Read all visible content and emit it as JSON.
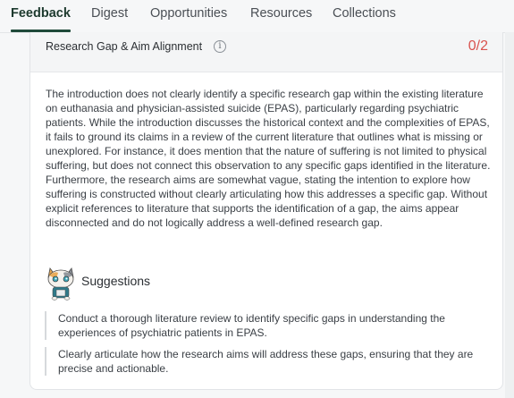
{
  "tabs": [
    {
      "label": "Feedback",
      "active": true
    },
    {
      "label": "Digest",
      "active": false
    },
    {
      "label": "Opportunities",
      "active": false
    },
    {
      "label": "Resources",
      "active": false
    },
    {
      "label": "Collections",
      "active": false
    }
  ],
  "section": {
    "title": "Research Gap & Aim Alignment",
    "info_icon": "info-icon",
    "score": "0/2",
    "score_color": "#d9534f",
    "body": "The introduction does not clearly identify a specific research gap within the existing literature on euthanasia and physician-assisted suicide (EPAS), particularly regarding psychiatric patients. While the introduction discusses the historical context and the complexities of EPAS, it fails to ground its claims in a review of the current literature that outlines what is missing or unexplored. For instance, it does mention that the nature of suffering is not limited to physical suffering, but does not connect this observation to any specific gaps identified in the literature. Furthermore, the research aims are somewhat vague, stating the intention to explore how suffering is constructed without clearly articulating how this addresses a specific gap. Without explicit references to literature that supports the identification of a gap, the aims appear disconnected and do not logically address a well-defined research gap."
  },
  "suggestions": {
    "title": "Suggestions",
    "mascot_icon": "cat-mascot-icon",
    "items": [
      "Conduct a thorough literature review to identify specific gaps in understanding the experiences of psychiatric patients in EPAS.",
      "Clearly articulate how the research aims will address these gaps, ensuring that they are precise and actionable."
    ]
  },
  "colors": {
    "accent": "#1f4a3a",
    "score_red": "#d9534f"
  }
}
